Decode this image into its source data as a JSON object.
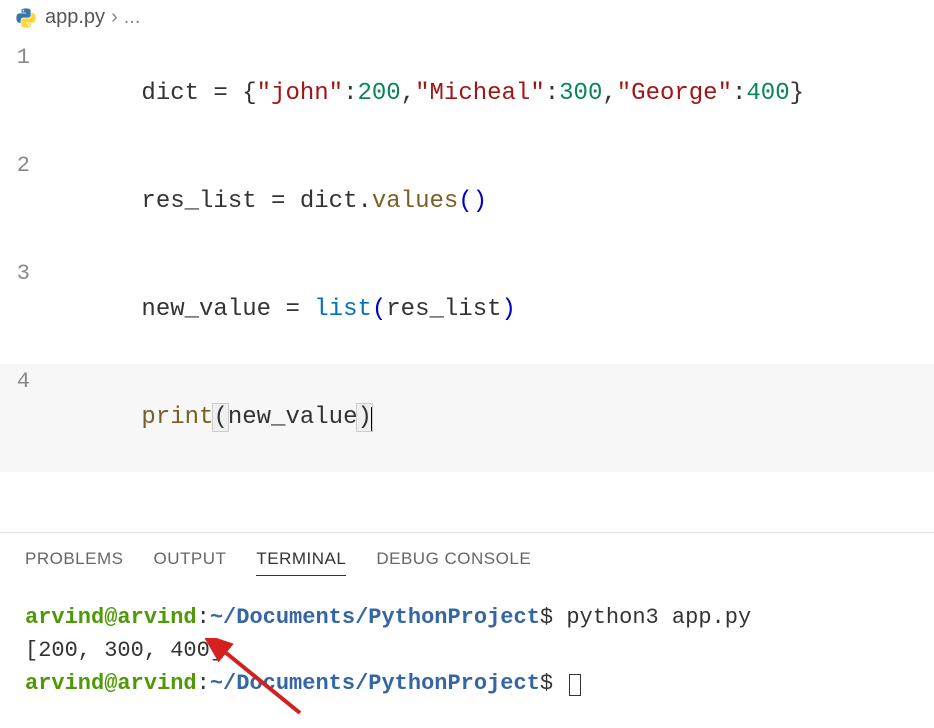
{
  "breadcrumb": {
    "filename": "app.py",
    "dots": "..."
  },
  "code": {
    "lines": [
      "1",
      "2",
      "3",
      "4"
    ],
    "line1": {
      "var": "dict",
      "eq": " = ",
      "open": "{",
      "k1": "\"john\"",
      "c1": ":",
      "v1": "200",
      "s1": ",",
      "k2": "\"Micheal\"",
      "c2": ":",
      "v2": "300",
      "s2": ",",
      "k3": "\"George\"",
      "c3": ":",
      "v3": "400",
      "close": "}"
    },
    "line2": {
      "var": "res_list",
      "eq": " = ",
      "obj": "dict",
      "dot": ".",
      "method": "values",
      "parens": "()"
    },
    "line3": {
      "var": "new_value",
      "eq": " = ",
      "func": "list",
      "open": "(",
      "arg": "res_list",
      "close": ")"
    },
    "line4": {
      "func": "print",
      "open": "(",
      "arg": "new_value",
      "close": ")"
    }
  },
  "panel": {
    "tabs": {
      "problems": "PROBLEMS",
      "output": "OUTPUT",
      "terminal": "TERMINAL",
      "debug": "DEBUG CONSOLE"
    }
  },
  "terminal": {
    "user": "arvind",
    "host": "arvind",
    "path": "/Documents/PythonProject",
    "command": "python3 app.py",
    "output": "[200, 300, 400]"
  }
}
